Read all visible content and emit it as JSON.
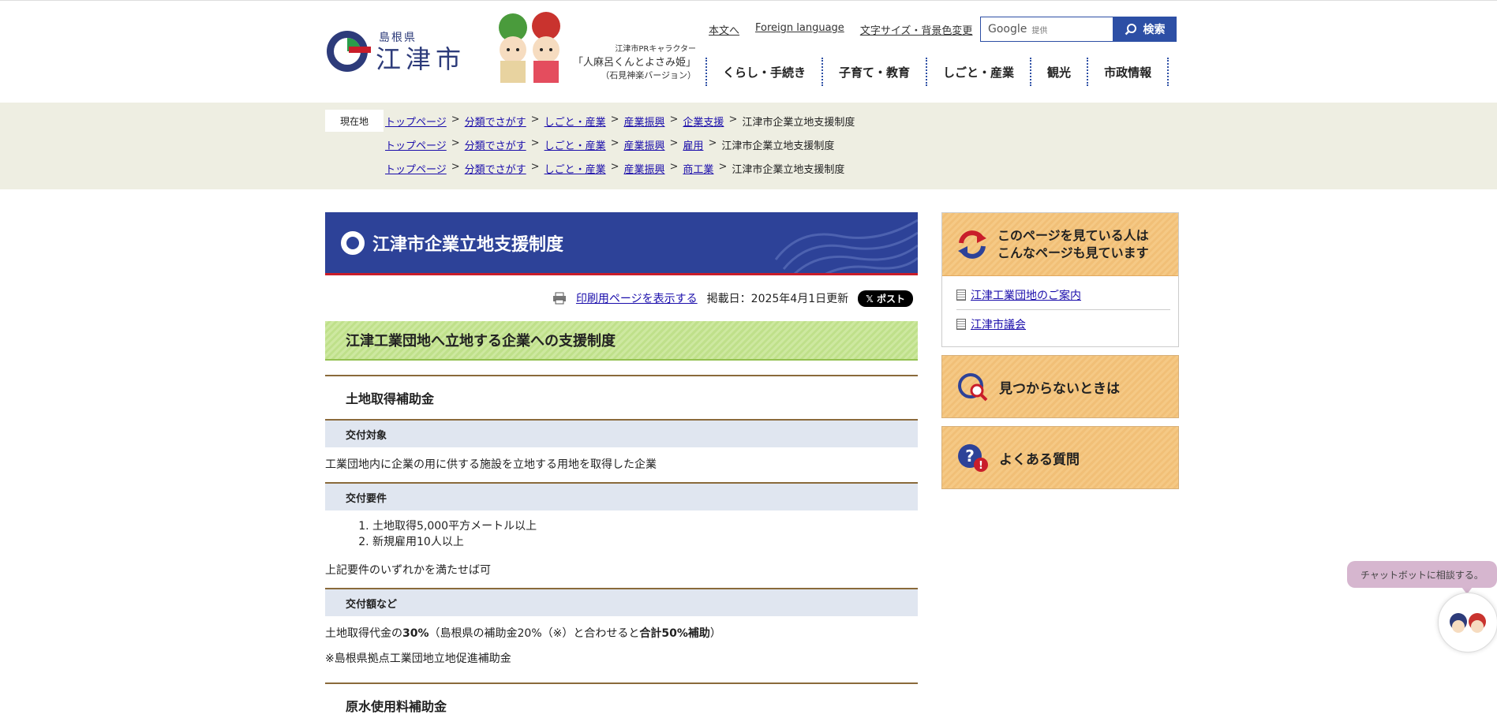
{
  "header": {
    "pref": "島根県",
    "city": "江津市",
    "mascot_caption_1": "江津市PRキャラクター",
    "mascot_caption_2": "「人麻呂くんとよさみ姫」",
    "mascot_caption_3": "（石見神楽バージョン）",
    "util_links": [
      "本文へ",
      "Foreign language",
      "文字サイズ・背景色変更"
    ],
    "search_brand": "Google",
    "search_provider": "提供",
    "search_button": "検索",
    "nav": [
      "くらし・手続き",
      "子育て・教育",
      "しごと・産業",
      "観光",
      "市政情報"
    ]
  },
  "breadcrumb": {
    "label": "現在地",
    "rows": [
      [
        "トップページ",
        "分類でさがす",
        "しごと・産業",
        "産業振興",
        "企業支援",
        "江津市企業立地支援制度"
      ],
      [
        "トップページ",
        "分類でさがす",
        "しごと・産業",
        "産業振興",
        "雇用",
        "江津市企業立地支援制度"
      ],
      [
        "トップページ",
        "分類でさがす",
        "しごと・産業",
        "産業振興",
        "商工業",
        "江津市企業立地支援制度"
      ]
    ]
  },
  "main": {
    "title": "江津市企業立地支援制度",
    "print_link": "印刷用ページを表示する",
    "updated": "掲載日：2025年4月1日更新",
    "post_button": "ポスト",
    "section_title": "江津工業団地へ立地する企業への支援制度",
    "subsection_1": "土地取得補助金",
    "h_target": "交付対象",
    "target_text": "工業団地内に企業の用に供する施設を立地する用地を取得した企業",
    "h_requirements": "交付要件",
    "requirements": [
      "土地取得5,000平方メートル以上",
      "新規雇用10人以上"
    ],
    "requirements_note": "上記要件のいずれかを満たせば可",
    "h_amount": "交付額など",
    "amount_pre": "土地取得代金の",
    "amount_bold_1": "30%",
    "amount_mid": "（島根県の補助金20%（※）と合わせると",
    "amount_bold_2": "合計50%補助",
    "amount_post": "）",
    "amount_note": "※島根県拠点工業団地立地促進補助金",
    "subsection_2": "原水使用料補助金"
  },
  "sidebar": {
    "related_title_1": "このページを見ている人は",
    "related_title_2": "こんなページも見ています",
    "related_links": [
      "江津工業団地のご案内",
      "江津市議会"
    ],
    "not_found": "見つからないときは",
    "faq": "よくある質問"
  },
  "chatbot": {
    "bubble": "チャットボットに相談する。"
  },
  "colors": {
    "brand_blue": "#2d4298",
    "accent_red": "#c91d2a",
    "green_band": "#cde8a0",
    "orange_card": "#f5c985"
  }
}
